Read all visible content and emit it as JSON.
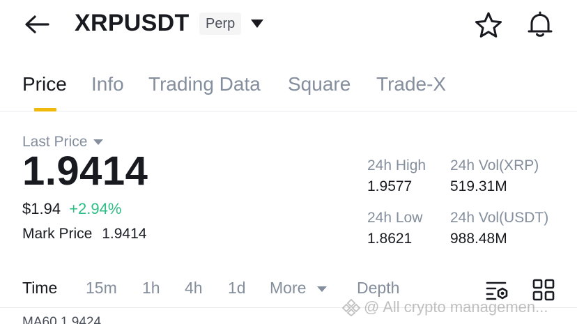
{
  "header": {
    "symbol": "XRPUSDT",
    "badge": "Perp",
    "icons": [
      "back-arrow-icon",
      "caret-down-icon",
      "star-icon",
      "bell-icon"
    ]
  },
  "tabs": [
    {
      "label": "Price",
      "active": true
    },
    {
      "label": "Info",
      "active": false
    },
    {
      "label": "Trading Data",
      "active": false
    },
    {
      "label": "Square",
      "active": false
    },
    {
      "label": "Trade-X",
      "active": false
    }
  ],
  "price": {
    "last_price_label": "Last Price",
    "last_price": "1.9414",
    "usd_price": "$1.94",
    "change": "+2.94%",
    "mark_label": "Mark Price",
    "mark_value": "1.9414"
  },
  "stats": {
    "high_label": "24h High",
    "high_value": "1.9577",
    "vol_xrp_label": "24h Vol(XRP)",
    "vol_xrp_value": "519.31M",
    "low_label": "24h Low",
    "low_value": "1.8621",
    "vol_usdt_label": "24h Vol(USDT)",
    "vol_usdt_value": "988.48M"
  },
  "intervals": {
    "time": "Time",
    "m15": "15m",
    "h1": "1h",
    "h4": "4h",
    "d1": "1d",
    "more": "More",
    "depth": "Depth"
  },
  "chart": {
    "ma_label": "MA60 1.9424"
  },
  "watermark": {
    "text": "@ All crypto managemen..."
  },
  "colors": {
    "accent": "#f0b90b",
    "up": "#2ebd85",
    "text_primary": "#181a20",
    "text_secondary": "#848e9c"
  }
}
